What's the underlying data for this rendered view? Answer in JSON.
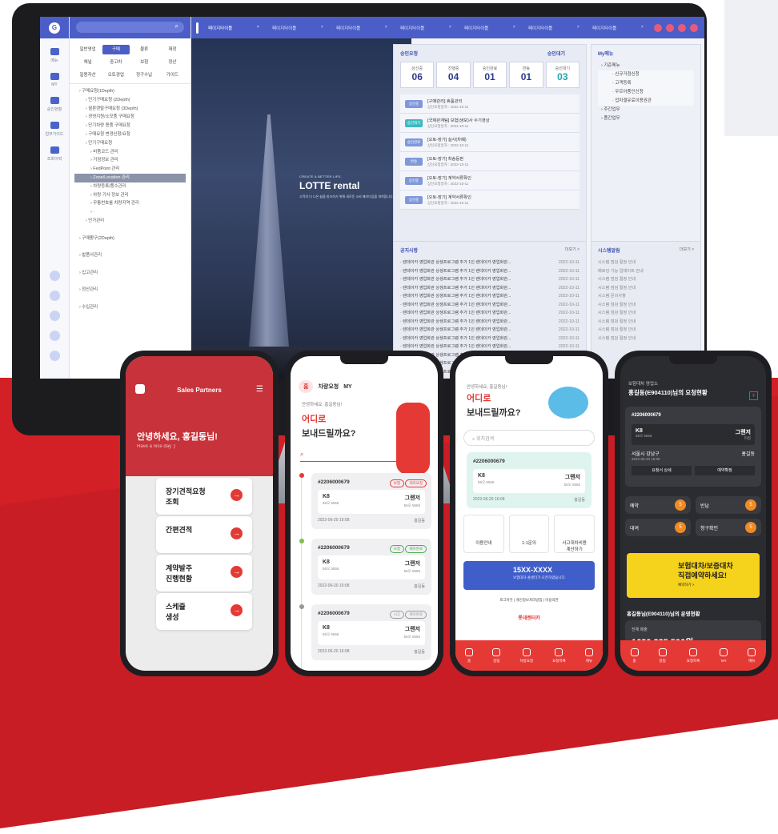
{
  "desktop": {
    "rail": [
      {
        "label": "메뉴"
      },
      {
        "label": "MY"
      },
      {
        "label": "승인현황"
      },
      {
        "label": "업무가이드"
      },
      {
        "label": "조회이력"
      }
    ],
    "categories": [
      {
        "label": "일반영업",
        "on": false
      },
      {
        "label": "구매",
        "on": true
      },
      {
        "label": "물류",
        "on": false
      },
      {
        "label": "재정",
        "on": false
      },
      {
        "label": "채널",
        "on": false
      },
      {
        "label": "중고차",
        "on": false
      },
      {
        "label": "보험",
        "on": false
      },
      {
        "label": "정산",
        "on": false
      },
      {
        "label": "일용자산",
        "on": false
      },
      {
        "label": "오토경업",
        "on": false
      },
      {
        "label": "정구수납",
        "on": false
      },
      {
        "label": "가이드",
        "on": false
      }
    ],
    "tree": [
      {
        "label": "구매요청(1Depth)",
        "lv": "l1",
        "sel": false
      },
      {
        "label": "단기구매요청 (2Depth)",
        "lv": "l2",
        "sel": false
      },
      {
        "label": "월론렌탈구매요청 (3Depth)",
        "lv": "l2",
        "sel": false
      },
      {
        "label": "경영지원/소모품 구매요청",
        "lv": "l2",
        "sel": false
      },
      {
        "label": "단기차량 용품 구매요청",
        "lv": "l2",
        "sel": false
      },
      {
        "label": "구매요청 변경신청/요청",
        "lv": "l2",
        "sel": false
      },
      {
        "label": "단기구매요청",
        "lv": "l2",
        "sel": false
      },
      {
        "label": "비품코드 관리",
        "lv": "l3",
        "sel": false
      },
      {
        "label": "거점정보 관리",
        "lv": "l3",
        "sel": false
      },
      {
        "label": "FedPoint 관리",
        "lv": "l3",
        "sel": false
      },
      {
        "label": "Zone/Location 관리",
        "lv": "l3",
        "sel": true
      },
      {
        "label": "차량등록/품수관리",
        "lv": "l3",
        "sel": false
      },
      {
        "label": "차량 기사 정보 관리",
        "lv": "l3",
        "sel": false
      },
      {
        "label": "무통번호를 차량지역 관리",
        "lv": "l3",
        "sel": false
      },
      {
        "label": "·",
        "lv": "l3",
        "sel": false
      },
      {
        "label": "단가관리",
        "lv": "l2",
        "sel": false
      },
      {
        "label": "",
        "lv": "l1",
        "sel": false
      },
      {
        "label": "구매활구(2Depth)",
        "lv": "l1",
        "sel": false
      },
      {
        "label": "",
        "lv": "l1",
        "sel": false
      },
      {
        "label": "발품사관리",
        "lv": "l1",
        "sel": false
      },
      {
        "label": "",
        "lv": "l1",
        "sel": false
      },
      {
        "label": "입고관리",
        "lv": "l1",
        "sel": false
      },
      {
        "label": "",
        "lv": "l1",
        "sel": false
      },
      {
        "label": "정산관리",
        "lv": "l1",
        "sel": false
      },
      {
        "label": "",
        "lv": "l1",
        "sel": false
      },
      {
        "label": "수입관리",
        "lv": "l1",
        "sel": false
      }
    ],
    "tabs": [
      "페이지타이틀",
      "페이지타이틀",
      "페이지타이틀",
      "페이지타이틀",
      "페이지타이틀",
      "페이지타이틀",
      "페이지타이틀"
    ],
    "hero": {
      "small": "CREATE A BETTER LIFE,",
      "brand": "LOTTE rental",
      "desc": "고객의 더 나은 삶을 창조하기 위해 새로운 소비 패러다임을 개척합니다."
    },
    "approval": {
      "title": "승인요청",
      "title2": "승인대기",
      "stats": [
        {
          "k": "상신중",
          "v": "06",
          "hi": false
        },
        {
          "k": "진행중",
          "v": "04",
          "hi": false
        },
        {
          "k": "승인완료",
          "v": "01",
          "hi": false
        },
        {
          "k": "반송",
          "v": "01",
          "hi": false
        },
        {
          "k": "승인대기",
          "v": "03",
          "hi": true
        }
      ],
      "rows": [
        {
          "b": "상신중",
          "c": "#7f98d8",
          "t": "[구매관리] 휴품관리",
          "d": "상신요청일자 : 2022-10-11"
        },
        {
          "b": "승인대기",
          "c": "#3fb9c0",
          "t": "[국제관계팀] 보험(생보)사 수기영상",
          "d": "상신요청일자 : 2022-10-11"
        },
        {
          "b": "승인완료",
          "c": "#7f98d8",
          "t": "[오토-장기] 실사(차폐)",
          "d": "상신요청일자 : 2022-10-11"
        },
        {
          "b": "반송",
          "c": "#7f98d8",
          "t": "[오토-장기] 착송등판",
          "d": "상신요청일자 : 2022-10-11"
        },
        {
          "b": "상신중",
          "c": "#7f98d8",
          "t": "[오토-장기] 계약서류확인",
          "d": "상신요청일자 : 2022-10-11"
        },
        {
          "b": "상신중",
          "c": "#7f98d8",
          "t": "[오토-장기] 계약서류확인",
          "d": "상신요청일자 : 2022-10-11"
        }
      ]
    },
    "mymenu": {
      "title": "My메뉴",
      "items": [
        {
          "t": "기준메뉴",
          "s": false
        },
        {
          "t": "신규거점신청",
          "s": true
        },
        {
          "t": "고객등록",
          "s": true
        },
        {
          "t": "우르아품인신청",
          "s": true
        },
        {
          "t": "업차결유료이용권관",
          "s": true
        },
        {
          "t": "주간업무",
          "s": false
        },
        {
          "t": "품간업무",
          "s": false
        }
      ]
    },
    "notice": {
      "title": "공지사항",
      "more": "더보기 >",
      "items": [
        "렌데이카 영업화관 상생프로그램 추가 1인 렌데이카 영업화관..."
      ],
      "date": "2022-10-11"
    },
    "sysalert": {
      "title": "시스템알림",
      "more": "더보기 >",
      "items": [
        "시스템 점검 절정 안내",
        "패로잉 기능 업데이트 안내",
        "시스템 점검 절정 안내",
        "시스템 점검 절정 안내",
        "시스템 문의사항",
        "시스템 점검 절정 안내",
        "시스템 점검 절정 안내",
        "시스템 점검 절정 안내",
        "시스템 점검 절정 안내",
        "시스템 점검 절정 안내"
      ]
    }
  },
  "phone1": {
    "title": "Sales Partners",
    "greet": "안녕하세요, 홍길동님!",
    "nice": "Have a nice day :)",
    "cards": [
      "장기견적요청\n조회",
      "간편견적",
      "계약발주\n진행현황",
      "스케쥴\n생성"
    ]
  },
  "phone2": {
    "tabs": [
      "홈",
      "차량요청",
      "MY"
    ],
    "hello": "안녕하세요, 홍길동님!",
    "q1": "어디로",
    "q2": "보내드릴까요?",
    "reqs": [
      {
        "no": "#2206000679",
        "tags": [
          "보험",
          "대차요청"
        ],
        "car": "K8",
        "plate": "55오 5555",
        "to": "그랜저",
        "plate2": "55오 5555",
        "date": "2022-06-20 16:08",
        "name": "홍길동",
        "dot": "#e53935"
      },
      {
        "no": "#2206000679",
        "tags": [
          "보험",
          "배차완료"
        ],
        "car": "K8",
        "plate": "55오 5555",
        "to": "그랜저",
        "plate2": "55오 5555",
        "date": "2022-06-20 16:08",
        "name": "홍길동",
        "dot": "#7cc04b"
      },
      {
        "no": "#2206000679",
        "tags": [
          "시고",
          "배차완료"
        ],
        "car": "K8",
        "plate": "55오 5555",
        "to": "그랜저",
        "plate2": "55오 5555",
        "date": "2022-06-20 16:08",
        "name": "홍길동",
        "dot": "#999"
      }
    ]
  },
  "phone3": {
    "hello": "안녕하세요, 홍길동님!",
    "q1": "어디로",
    "q2": "보내드릴까요?",
    "search": "위치검색",
    "no": "#2206000679",
    "car": "K8",
    "plate": "55오 5555",
    "to": "그랜저",
    "plate2": "55오 5555",
    "date": "2022-06-20 16:08",
    "name": "홍길동",
    "menus": [
      "이용안내",
      "1:1문의",
      "사고대차비용\n계산하기"
    ],
    "tel": "15XX-XXXX",
    "telsub": "보험대차 콜센터가 오픈하였습니다.",
    "links": "로그아웃 | 개인정보처리방침 | 이용약관",
    "brand": "롯데렌터카",
    "nav": [
      "홈",
      "알림",
      "차량요청",
      "요청목록",
      "메뉴"
    ]
  },
  "phone4": {
    "company": "보험대차 영업소",
    "title": "홍길동(E904110)님의 요청현황",
    "no": "#2206000679",
    "car": "K8",
    "plate": "55오 5555",
    "to": "그랜저",
    "plate2": "미정",
    "loc": "서울시 강남구",
    "date": "2022-06-20 16:08",
    "name": "홍길동",
    "btn1": "요청서 상세",
    "btn2": "예약확정",
    "counts": [
      {
        "k": "예약",
        "v": "5"
      },
      {
        "k": "반납",
        "v": "5"
      },
      {
        "k": "대여",
        "v": "5"
      },
      {
        "k": "청구확인",
        "v": "5"
      }
    ],
    "banner1": "보험대차/보증대차",
    "banner2": "직접예약하세요!",
    "banner3": "예약하기 >",
    "status": "홍길동님(E904110)님의 운영현황",
    "sales": "전체 매출",
    "amount": "1630 235 500원",
    "nav": [
      "홈",
      "알림",
      "요청목록",
      "MY",
      "메뉴"
    ]
  }
}
